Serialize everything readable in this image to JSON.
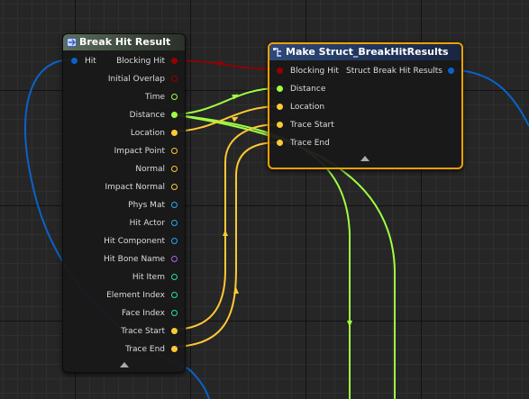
{
  "colors": {
    "bool": "#940000",
    "float": "#9fff44",
    "vector": "#ffc934",
    "struct": "#0a62c8",
    "object": "#2ba6f5",
    "name": "#ac67d4",
    "int": "#1fe0ae",
    "breakHeader": "#4b5a4b",
    "makeHeader": "#264a86",
    "selection": "#f0a000"
  },
  "break_node": {
    "title": "Break Hit Result",
    "icon": "struct-node-icon",
    "input_pin": {
      "label": "Hit",
      "type": "struct"
    },
    "output_pins": [
      {
        "label": "Blocking Hit",
        "type": "bool",
        "connected": true
      },
      {
        "label": "Initial Overlap",
        "type": "bool",
        "connected": false
      },
      {
        "label": "Time",
        "type": "float",
        "connected": false
      },
      {
        "label": "Distance",
        "type": "float",
        "connected": true
      },
      {
        "label": "Location",
        "type": "vector",
        "connected": true
      },
      {
        "label": "Impact Point",
        "type": "vector",
        "connected": false
      },
      {
        "label": "Normal",
        "type": "vector",
        "connected": false
      },
      {
        "label": "Impact Normal",
        "type": "vector",
        "connected": false
      },
      {
        "label": "Phys Mat",
        "type": "object",
        "connected": false
      },
      {
        "label": "Hit Actor",
        "type": "object",
        "connected": false
      },
      {
        "label": "Hit Component",
        "type": "object",
        "connected": false
      },
      {
        "label": "Hit Bone Name",
        "type": "name",
        "connected": false
      },
      {
        "label": "Hit Item",
        "type": "int",
        "connected": false
      },
      {
        "label": "Element Index",
        "type": "int",
        "connected": false
      },
      {
        "label": "Face Index",
        "type": "int",
        "connected": false
      },
      {
        "label": "Trace Start",
        "type": "vector",
        "connected": true
      },
      {
        "label": "Trace End",
        "type": "vector",
        "connected": true
      }
    ]
  },
  "make_node": {
    "title": "Make Struct_BreakHitResults",
    "icon": "make-struct-icon",
    "input_pins": [
      {
        "label": "Blocking Hit",
        "type": "bool"
      },
      {
        "label": "Distance",
        "type": "float"
      },
      {
        "label": "Location",
        "type": "vector"
      },
      {
        "label": "Trace Start",
        "type": "vector"
      },
      {
        "label": "Trace End",
        "type": "vector"
      }
    ],
    "output_pin": {
      "label": "Struct Break Hit Results",
      "type": "struct"
    }
  }
}
